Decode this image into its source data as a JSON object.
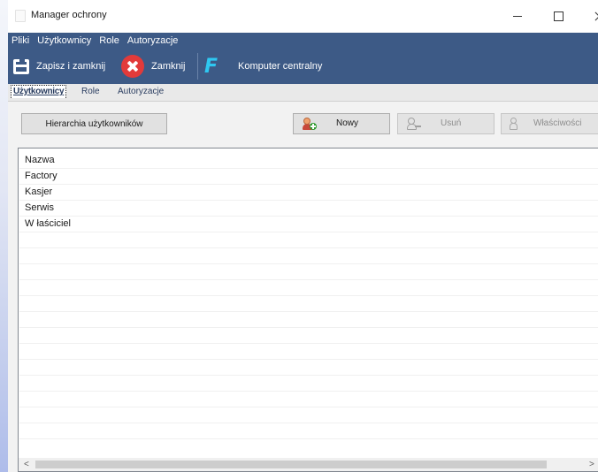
{
  "window": {
    "title": "Manager ochrony"
  },
  "menu": {
    "items": [
      "Pliki",
      "Użytkownicy",
      "Role",
      "Autoryzacje"
    ]
  },
  "toolbar": {
    "save_label": "Zapisz i zamknij",
    "close_label": "Zamknij",
    "central_label": "Komputer centralny",
    "central_glyph": "F",
    "accent_color": "#3d5a86"
  },
  "tabs": [
    {
      "label": "Użytkownicy",
      "selected": true
    },
    {
      "label": "Role",
      "selected": false
    },
    {
      "label": "Autoryzacje",
      "selected": false
    }
  ],
  "buttons": {
    "hierarchy": "Hierarchia użytkowników",
    "new": "Nowy",
    "delete": "Usuń",
    "properties": "Właściwości"
  },
  "list": {
    "header": "Nazwa",
    "items": [
      "Factory",
      "Kasjer",
      "Serwis",
      "W łaściciel"
    ],
    "empty_rows": 13
  },
  "scrollbar": {
    "left": "<",
    "right": ">"
  }
}
